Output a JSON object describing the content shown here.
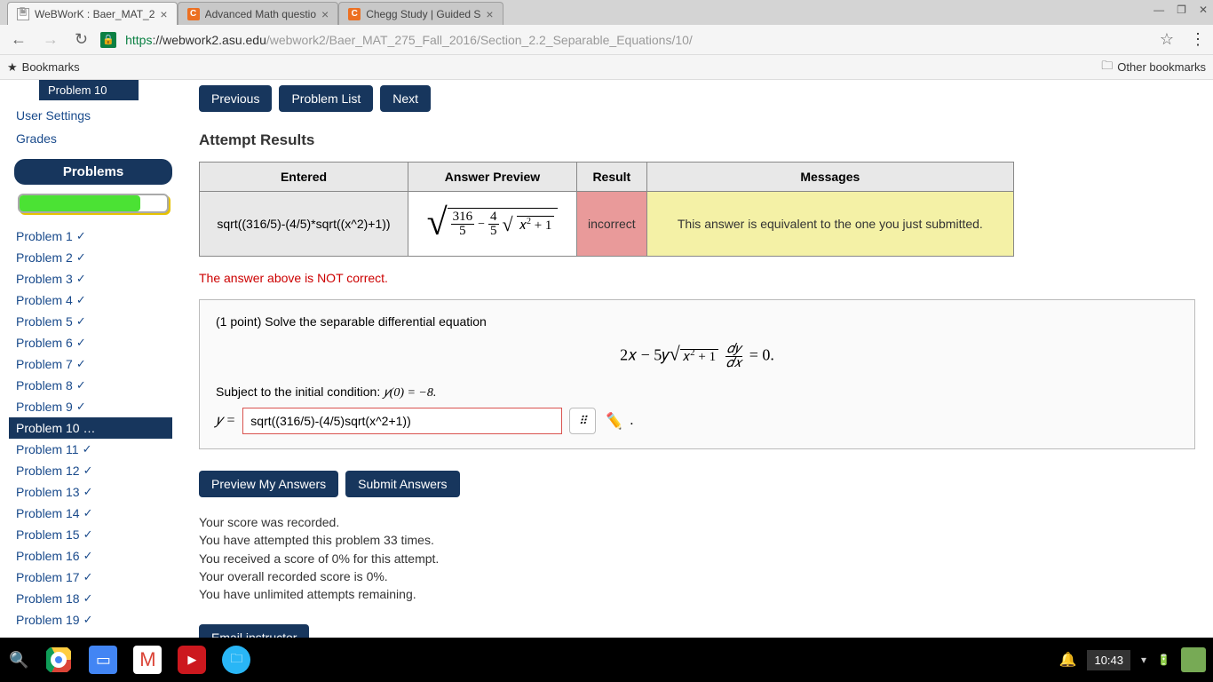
{
  "tabs": [
    {
      "title": "WeBWorK : Baer_MAT_2",
      "favicon": "doc"
    },
    {
      "title": "Advanced Math questio",
      "favicon": "c"
    },
    {
      "title": "Chegg Study | Guided S",
      "favicon": "c"
    }
  ],
  "url": {
    "proto": "https",
    "host": "://webwork2.asu.edu",
    "path": "/webwork2/Baer_MAT_275_Fall_2016/Section_2.2_Separable_Equations/10/"
  },
  "bookmarks_label": "Bookmarks",
  "other_bookmarks": "Other bookmarks",
  "sidebar": {
    "top_pill": "Problem 10",
    "user_settings": "User Settings",
    "grades": "Grades",
    "header": "Problems",
    "problems": [
      "Problem 1",
      "Problem 2",
      "Problem 3",
      "Problem 4",
      "Problem 5",
      "Problem 6",
      "Problem 7",
      "Problem 8",
      "Problem 9",
      "Problem 10 …",
      "Problem 11",
      "Problem 12",
      "Problem 13",
      "Problem 14",
      "Problem 15",
      "Problem 16",
      "Problem 17",
      "Problem 18",
      "Problem 19"
    ]
  },
  "nav": {
    "prev": "Previous",
    "list": "Problem List",
    "next": "Next"
  },
  "section_title": "Attempt Results",
  "table": {
    "h_entered": "Entered",
    "h_preview": "Answer Preview",
    "h_result": "Result",
    "h_messages": "Messages",
    "entered": "sqrt((316/5)-(4/5)*sqrt((x^2)+1))",
    "result": "incorrect",
    "message": "This answer is equivalent to the one you just submitted."
  },
  "error_text": "The answer above is NOT correct.",
  "question": {
    "points": "(1 point) Solve the separable differential equation",
    "subject_to": "Subject to the initial condition: ",
    "ic": "𝑦(0) = −8.",
    "y_label": "𝑦 ="
  },
  "answer_value": "sqrt((316/5)-(4/5)sqrt(x^2+1))",
  "buttons": {
    "preview": "Preview My Answers",
    "submit": "Submit Answers",
    "email": "Email instructor"
  },
  "score": {
    "l1": "Your score was recorded.",
    "l2": "You have attempted this problem 33 times.",
    "l3": "You received a score of 0% for this attempt.",
    "l4": "Your overall recorded score is 0%.",
    "l5": "You have unlimited attempts remaining."
  },
  "clock": "10:43"
}
